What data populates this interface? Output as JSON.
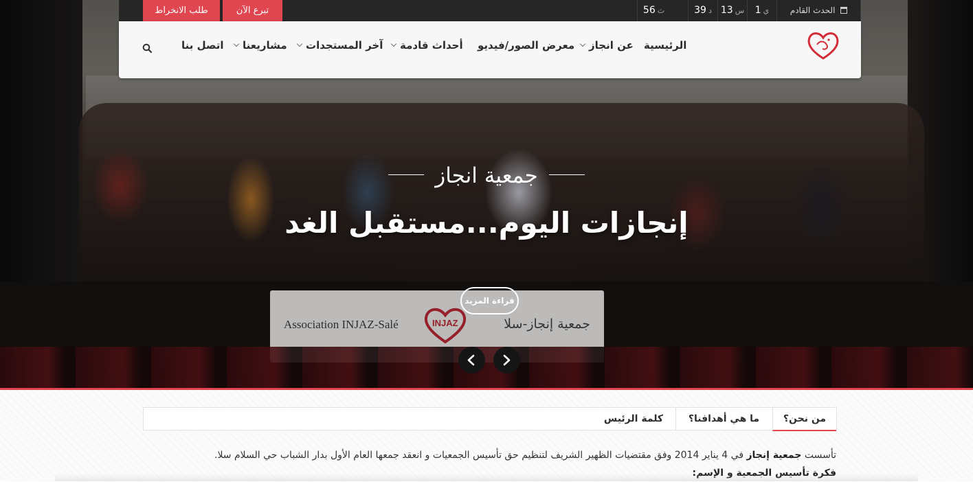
{
  "topbar": {
    "next_event_label": "الحدث القادم",
    "countdown": [
      {
        "value": "1",
        "unit": "ي"
      },
      {
        "value": "13",
        "unit": "س"
      },
      {
        "value": "39",
        "unit": "د"
      },
      {
        "value": "56",
        "unit": "ث"
      }
    ],
    "donate_label": "تبرع الآن",
    "join_label": "طلب الانخراط"
  },
  "nav": {
    "items": [
      {
        "label": "الرئيسية"
      },
      {
        "label": "عن انجاز"
      },
      {
        "label": "معرض الصور/فيديو"
      },
      {
        "label": "أحداث قادمة"
      },
      {
        "label": "آخر المستجدات"
      },
      {
        "label": "مشاريعنا"
      },
      {
        "label": "اتصل بنا"
      }
    ]
  },
  "hero": {
    "kicker": "جمعية انجاز",
    "headline": "إنجازات اليوم...مستقبل الغد",
    "read_more": "قراءة المزيد",
    "banner_left": "Association INJAZ-Salé",
    "banner_brand": "INJAZ",
    "banner_right": "جمعية إنجاز-سلا"
  },
  "tabs": [
    {
      "label": "من نحن؟"
    },
    {
      "label": "ما هي أهدافنا؟"
    },
    {
      "label": "كلمة الرئيس"
    }
  ],
  "content": {
    "intro_prefix": "تأسست",
    "intro_brand": "جمعية إنجاز",
    "intro_rest": "في 4 يناير 2014 وفق مقتضيات الظهير الشريف لتنظيم حق تأسيس الجمعيات و انعقد جمعها العام الأول بدار الشباب حي السلام سلا.",
    "subheading": "فكرة تأسيس الجمعية و الإسم:"
  },
  "colors": {
    "accent": "#e04650",
    "topbar_bg": "#262626",
    "nav_bg": "#f7f7f7"
  },
  "icons": {
    "calendar": "calendar-icon",
    "search": "search-icon",
    "prev": "chevron-left-icon",
    "next": "chevron-right-icon",
    "logo": "heart-logo"
  }
}
